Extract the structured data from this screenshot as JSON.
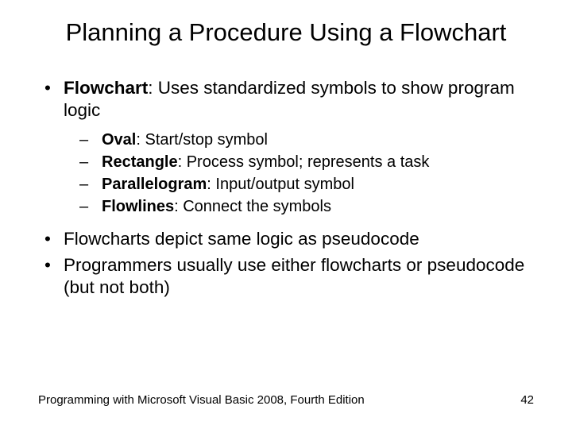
{
  "title": "Planning a Procedure Using a Flowchart",
  "bullet1": {
    "term": "Flowchart",
    "rest": ": Uses standardized symbols to show program logic"
  },
  "sub": [
    {
      "term": "Oval",
      "rest": ": Start/stop symbol"
    },
    {
      "term": "Rectangle",
      "rest": ": Process symbol; represents a task"
    },
    {
      "term": "Parallelogram",
      "rest": ": Input/output symbol"
    },
    {
      "term": "Flowlines",
      "rest": ": Connect the symbols"
    }
  ],
  "bullet2": "Flowcharts depict same logic as pseudocode",
  "bullet3": "Programmers usually use either flowcharts or pseudocode (but not both)",
  "footer_left": "Programming with Microsoft Visual Basic 2008, Fourth Edition",
  "footer_right": "42"
}
